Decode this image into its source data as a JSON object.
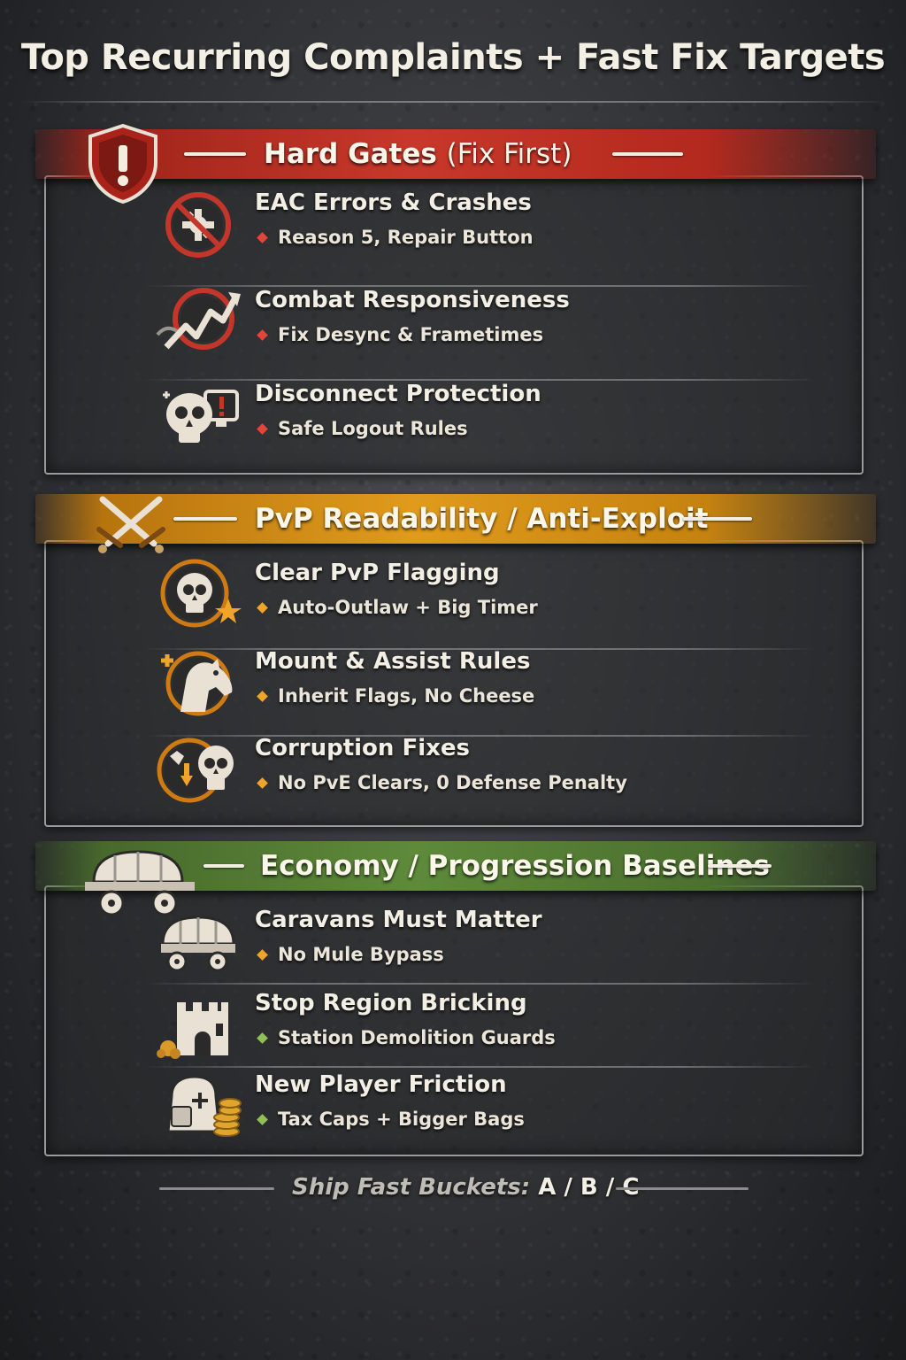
{
  "title": "Top Recurring Complaints + Fast Fix Targets",
  "colors": {
    "red_accent": "#c8382a",
    "orange_accent": "#e09b1c",
    "green_accent": "#5e8a3a",
    "red_bullet": "#e0463a",
    "orange_bullet": "#f0a42a",
    "green_bullet": "#8fbf55"
  },
  "sections": [
    {
      "label": "Hard Gates",
      "sublabel": "(Fix First)",
      "icon": "warning-shield-icon",
      "items": [
        {
          "title": "EAC Errors & Crashes",
          "detail": "Reason 5, Repair Button",
          "icon": "crash-icon"
        },
        {
          "title": "Combat Responsiveness",
          "detail": "Fix Desync & Frametimes",
          "icon": "lag-spike-icon"
        },
        {
          "title": "Disconnect Protection",
          "detail": "Safe Logout Rules",
          "icon": "skull-monitor-icon"
        }
      ]
    },
    {
      "label": "PvP Readability / Anti-Exploit",
      "icon": "crossed-swords-icon",
      "items": [
        {
          "title": "Clear PvP Flagging",
          "detail": "Auto-Outlaw + Big Timer",
          "icon": "skull-star-icon"
        },
        {
          "title": "Mount & Assist Rules",
          "detail": "Inherit Flags, No Cheese",
          "icon": "horse-icon"
        },
        {
          "title": "Corruption Fixes",
          "detail": "No PvE Clears, 0 Defense Penalty",
          "icon": "corruption-skull-icon"
        }
      ]
    },
    {
      "label": "Economy / Progression Baselines",
      "icon": "wagon-icon",
      "items": [
        {
          "title": "Caravans Must Matter",
          "detail": "No Mule Bypass",
          "icon": "caravan-icon"
        },
        {
          "title": "Stop Region Bricking",
          "detail": "Station Demolition Guards",
          "icon": "castle-icon"
        },
        {
          "title": "New Player Friction",
          "detail": "Tax Caps + Bigger Bags",
          "icon": "bag-coins-icon"
        }
      ]
    }
  ],
  "footer": {
    "prefix": "Ship Fast Buckets:",
    "buckets": "A / B / C"
  }
}
